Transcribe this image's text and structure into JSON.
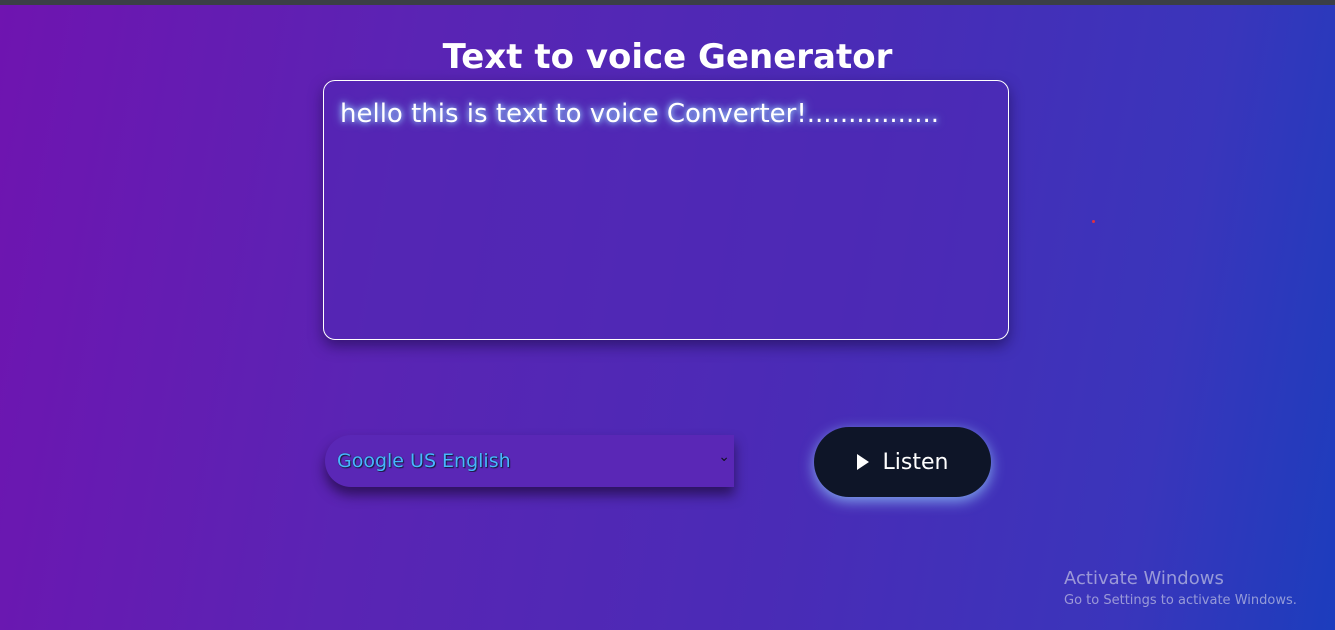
{
  "header": {
    "title": "Text to voice Generator"
  },
  "editor": {
    "value": "hello this is text to voice Converter!................"
  },
  "voice_select": {
    "selected": "Google US English",
    "arrow_icon": "chevron-down-icon"
  },
  "listen_button": {
    "label": "Listen",
    "icon": "play-icon"
  },
  "watermark": {
    "title": "Activate Windows",
    "subtitle": "Go to Settings to activate Windows."
  },
  "colors": {
    "gradient_start": "#6f14b0",
    "gradient_end": "#1c3dbd",
    "button_bg": "#0e1528",
    "select_text": "#48b6ff"
  }
}
